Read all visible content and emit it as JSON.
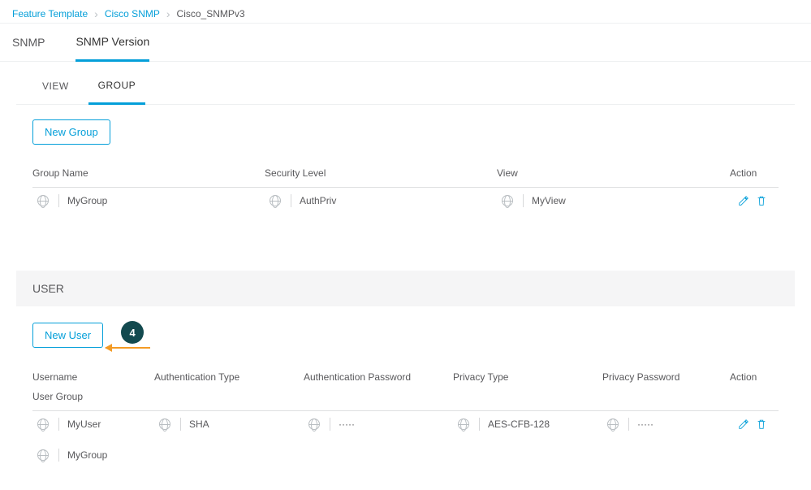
{
  "breadcrumbs": {
    "root": "Feature Template",
    "mid": "Cisco SNMP",
    "current": "Cisco_SNMPv3"
  },
  "mainTabs": {
    "snmp": "SNMP",
    "version": "SNMP Version"
  },
  "subTabs": {
    "view": "VIEW",
    "group": "GROUP"
  },
  "buttons": {
    "newGroup": "New Group",
    "newUser": "New User"
  },
  "groupTable": {
    "headers": {
      "name": "Group Name",
      "security": "Security Level",
      "view": "View",
      "action": "Action"
    },
    "row": {
      "name": "MyGroup",
      "security": "AuthPriv",
      "view": "MyView"
    }
  },
  "userSection": {
    "title": "USER"
  },
  "userTable": {
    "headers": {
      "username": "Username",
      "authType": "Authentication Type",
      "authPass": "Authentication Password",
      "privType": "Privacy Type",
      "privPass": "Privacy Password",
      "action": "Action",
      "userGroup": "User Group"
    },
    "row": {
      "username": "MyUser",
      "authType": "SHA",
      "authPass": "·····",
      "privType": "AES-CFB-128",
      "privPass": "·····",
      "userGroup": "MyGroup"
    }
  },
  "callout": {
    "step": "4"
  }
}
